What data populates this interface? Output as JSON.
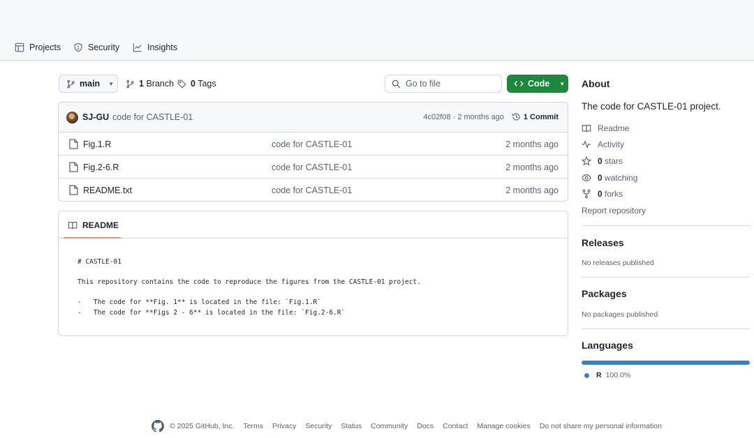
{
  "nav": {
    "items": [
      {
        "label": "Projects",
        "icon": "table-icon"
      },
      {
        "label": "Security",
        "icon": "shield-icon"
      },
      {
        "label": "Insights",
        "icon": "graph-icon"
      }
    ]
  },
  "repo": {
    "branch": "main",
    "branch_count": "1",
    "branch_label": "Branch",
    "tag_count": "0",
    "tag_label": "Tags",
    "search_placeholder": "Go to file",
    "code_button": "Code"
  },
  "commit": {
    "author": "SJ-GU",
    "message": "code for CASTLE-01",
    "hash_time": "4c02f08 · 2 months ago",
    "count_label": "1 Commit"
  },
  "files": [
    {
      "name": "Fig.1.R",
      "message": "code for CASTLE-01",
      "date": "2 months ago"
    },
    {
      "name": "Fig.2-6.R",
      "message": "code for CASTLE-01",
      "date": "2 months ago"
    },
    {
      "name": "README.txt",
      "message": "code for CASTLE-01",
      "date": "2 months ago"
    }
  ],
  "readme": {
    "tab_label": "README",
    "content": "# CASTLE-01\n\nThis repository contains the code to reproduce the figures from the CASTLE-01 project.\n\n-   The code for **Fig. 1** is located in the file: `Fig.1.R`\n-   The code for **Figs 2 - 6** is located in the file: `Fig.2-6.R`"
  },
  "about": {
    "title": "About",
    "description": "The code for CASTLE-01 project.",
    "readme": "Readme",
    "activity": "Activity",
    "stars_count": "0",
    "stars_label": "stars",
    "watching_count": "0",
    "watching_label": "watching",
    "forks_count": "0",
    "forks_label": "forks",
    "report": "Report repository"
  },
  "releases": {
    "title": "Releases",
    "empty": "No releases published"
  },
  "packages": {
    "title": "Packages",
    "empty": "No packages published"
  },
  "languages": {
    "title": "Languages",
    "name": "R",
    "percent": "100.0%",
    "fraction": 1.0,
    "color": "#3d7ec9"
  },
  "footer": {
    "copyright": "© 2025 GitHub, Inc.",
    "links": [
      "Terms",
      "Privacy",
      "Security",
      "Status",
      "Community",
      "Docs",
      "Contact",
      "Manage cookies",
      "Do not share my personal information"
    ]
  }
}
